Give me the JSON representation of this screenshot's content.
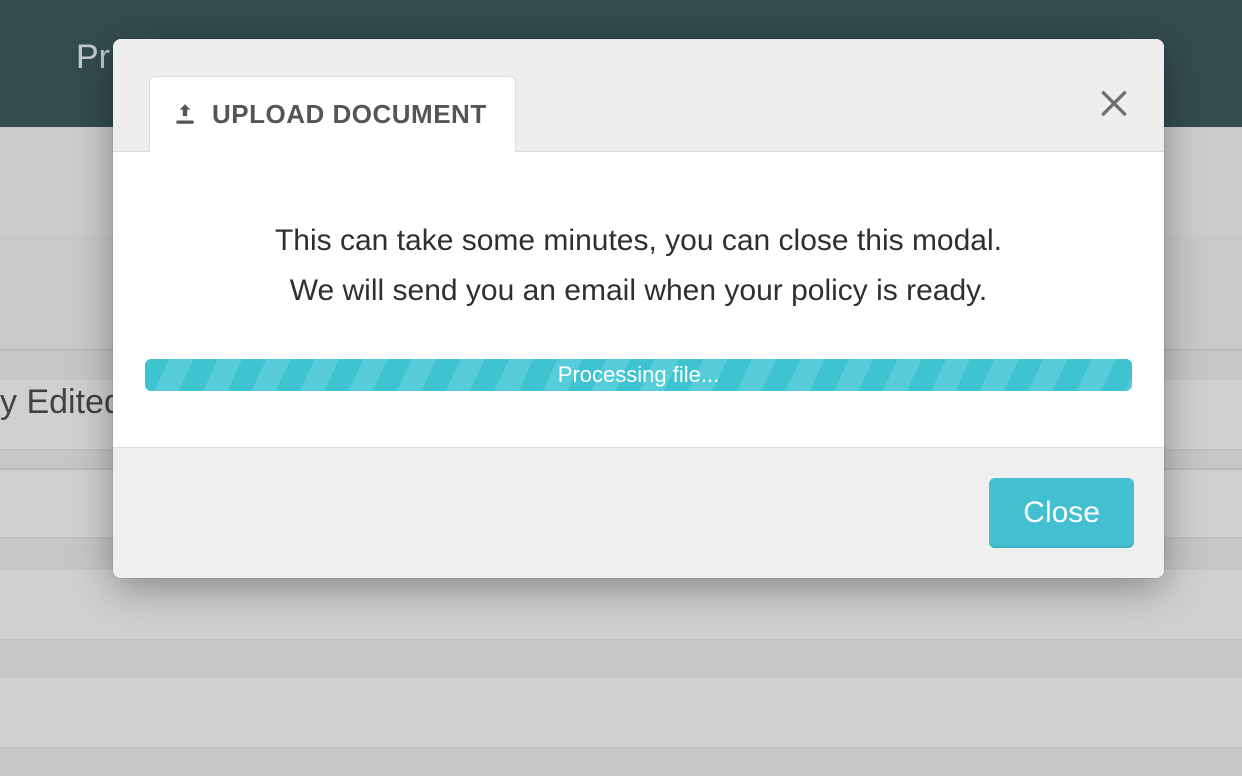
{
  "colors": {
    "accent": "#42bfd1",
    "header_bg": "#163a3f",
    "modal_header_bg": "#eeeeee",
    "modal_footer_bg": "#efefef",
    "close_icon": "#6f6f6f"
  },
  "background": {
    "page_title_fragment": "Pr",
    "row_label_fragment": "y Edited"
  },
  "modal": {
    "tab": {
      "icon": "upload-icon",
      "label": "UPLOAD DOCUMENT"
    },
    "close_icon": "close-icon",
    "body": {
      "line1": "This can take some minutes, you can close this modal.",
      "line2": "We will send you an email when your policy is ready.",
      "progress_text": "Processing file..."
    },
    "footer": {
      "close_label": "Close"
    }
  }
}
